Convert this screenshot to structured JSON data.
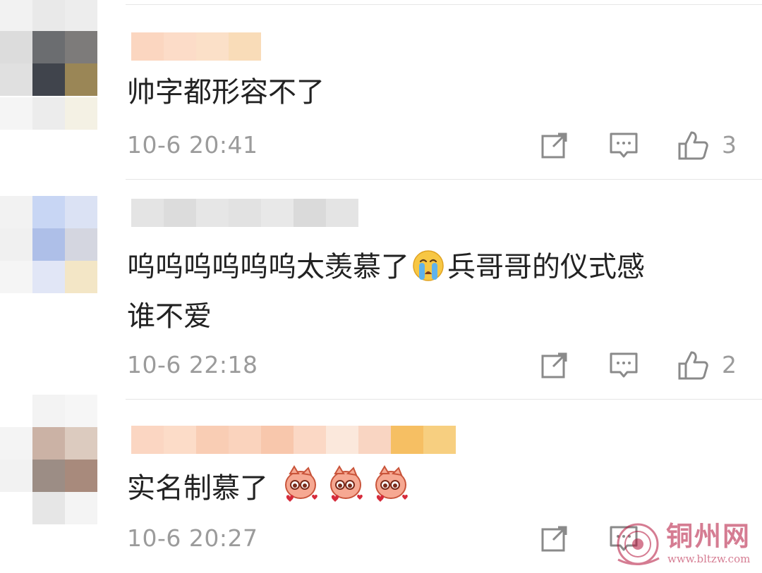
{
  "comments": [
    {
      "text": "帅字都形容不了",
      "time": "10-6 20:41",
      "likes": "3"
    },
    {
      "text_before": "呜呜呜呜呜呜太羡慕了",
      "emoji": "crying-face-emoji",
      "text_after": "兵哥哥的仪式感",
      "text_line2": "谁不爱",
      "time": "10-6 22:18",
      "likes": "2"
    },
    {
      "text": "实名制慕了",
      "emoji": "pink-cat-heart-sticker",
      "time": "10-6 20:27"
    }
  ],
  "icons": {
    "share": "share-icon",
    "reply": "reply-icon",
    "like": "thumbs-up-icon"
  },
  "colors": {
    "text": "#222222",
    "meta": "#9b9b9b",
    "divider": "#e6e6e6",
    "watermark": "#b3123a"
  },
  "watermark": {
    "title": "铜州网",
    "url": "www.bltzw.com"
  }
}
